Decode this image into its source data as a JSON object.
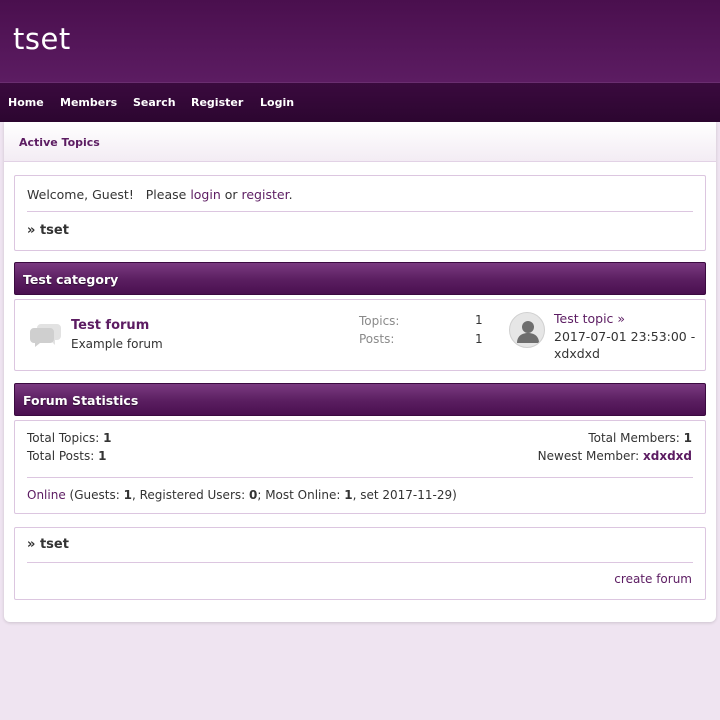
{
  "site": {
    "title": "tset"
  },
  "nav": {
    "items": [
      {
        "label": "Home"
      },
      {
        "label": "Members"
      },
      {
        "label": "Search"
      },
      {
        "label": "Register"
      },
      {
        "label": "Login"
      }
    ]
  },
  "subnav": {
    "active_topics": "Active Topics"
  },
  "welcome": {
    "prefix": "Welcome, Guest!   Please ",
    "login": "login",
    "or": " or ",
    "register": "register",
    "suffix": ".",
    "crumb_arrow": "» ",
    "crumb": "tset"
  },
  "category": {
    "title": "Test category",
    "forum": {
      "name": "Test forum",
      "description": "Example forum",
      "topics_label": "Topics:",
      "topics_value": "1",
      "posts_label": "Posts:",
      "posts_value": "1",
      "last_topic": "Test topic »",
      "last_date": "2017-07-01 23:53:00 -",
      "last_user": "xdxdxd"
    }
  },
  "stats": {
    "title": "Forum Statistics",
    "total_topics_label": "Total Topics: ",
    "total_topics": "1",
    "total_posts_label": "Total Posts: ",
    "total_posts": "1",
    "total_members_label": "Total Members: ",
    "total_members": "1",
    "newest_member_label": "Newest Member: ",
    "newest_member": "xdxdxd",
    "online_link": "Online",
    "guests_label": " (Guests: ",
    "guests": "1",
    "registered_label": ", Registered Users: ",
    "registered": "0",
    "most_online_label": "; Most Online: ",
    "most_online": "1",
    "most_online_suffix": ", set 2017-11-29)"
  },
  "footer": {
    "crumb_arrow": "» ",
    "crumb": "tset",
    "create_forum": "create forum"
  },
  "colors": {
    "accent": "#5c1c62",
    "header": "#4a0f4e",
    "nav": "#2c0630",
    "background": "#efe4f1"
  }
}
